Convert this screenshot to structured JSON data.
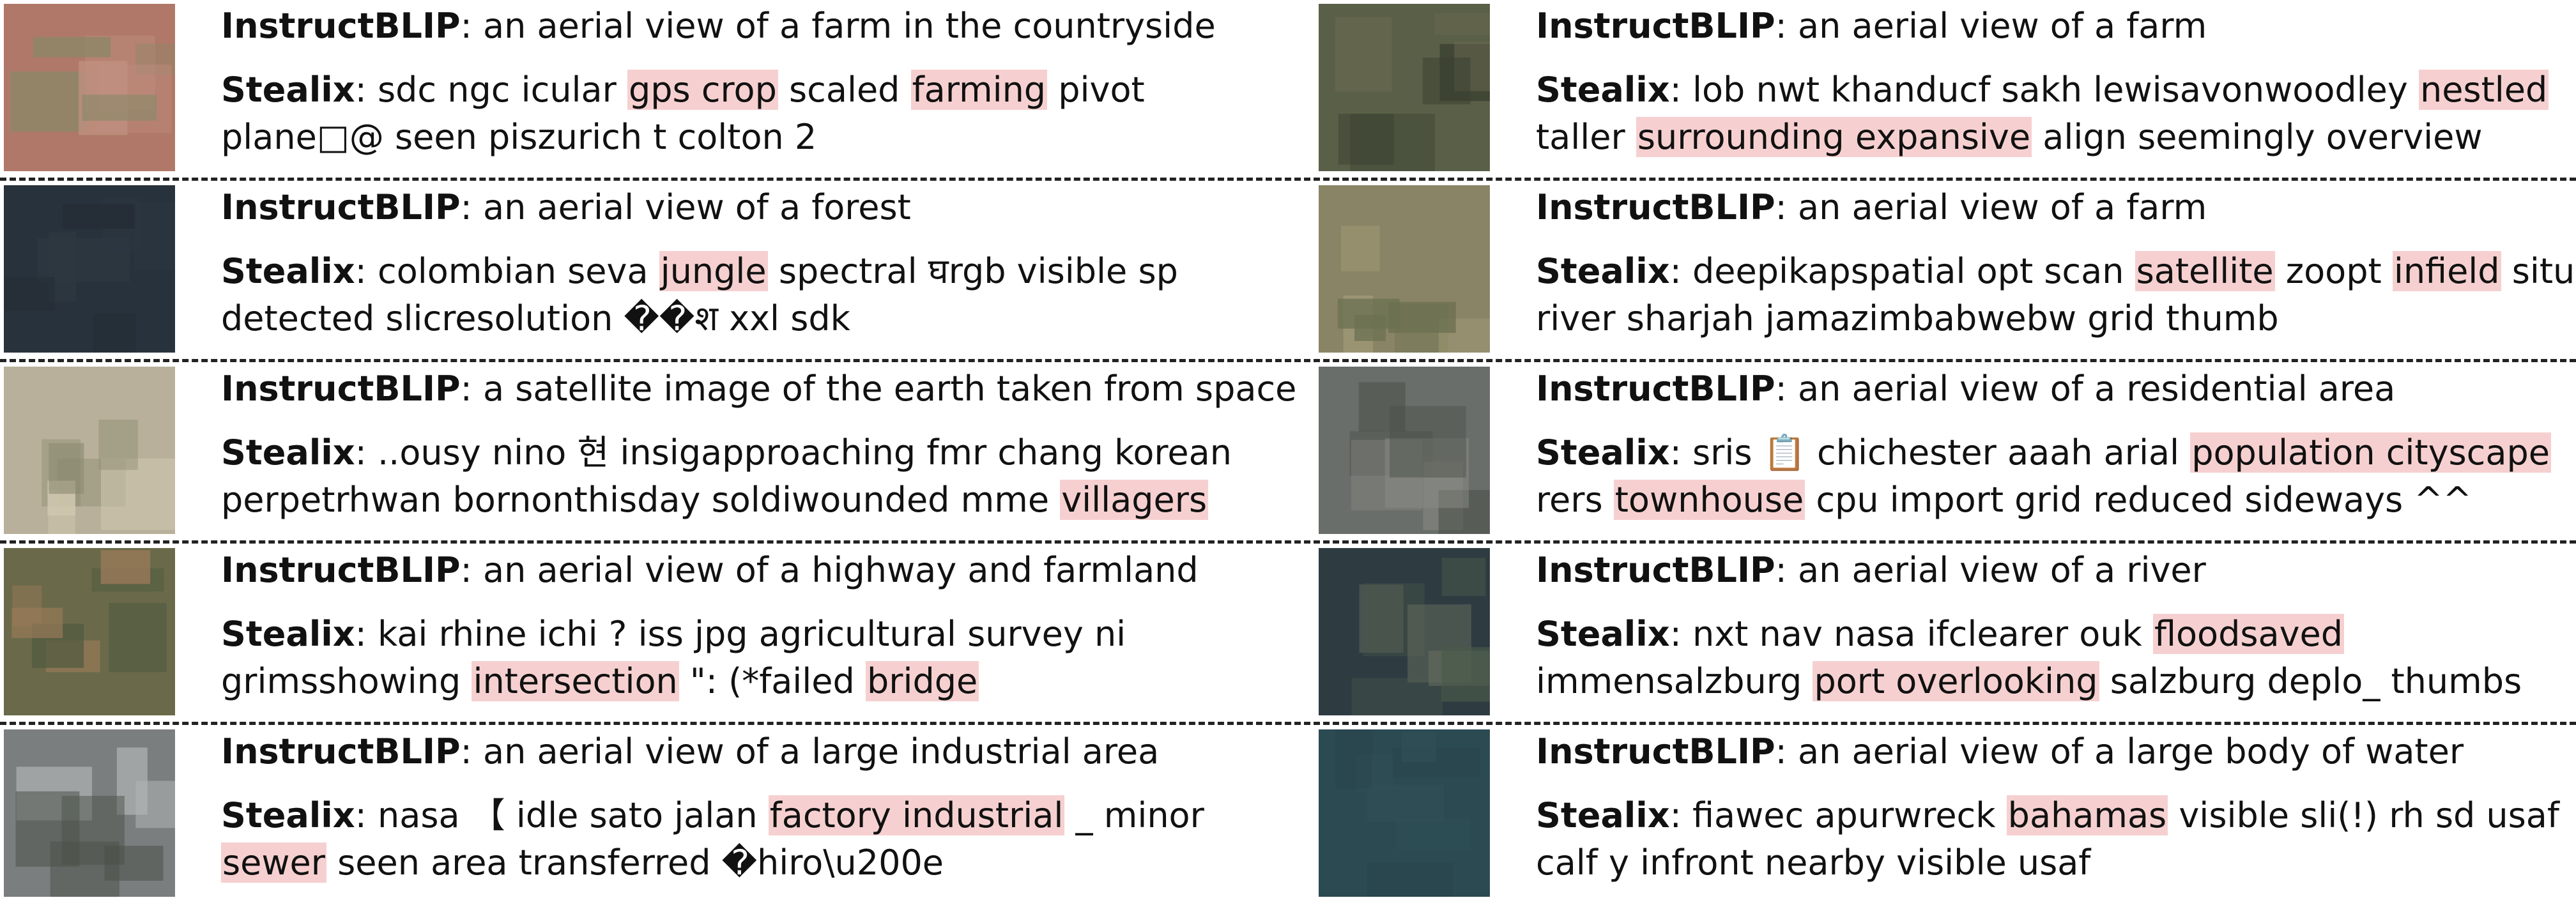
{
  "labels": {
    "model_a": "InstructBLIP",
    "model_b": "Stealix",
    "colon": ":"
  },
  "rows": [
    {
      "instructblip": "an aerial view of a farm in the countryside",
      "stealix": [
        {
          "t": "sdc ngc icular "
        },
        {
          "t": "gps crop",
          "h": true
        },
        {
          "t": " scaled "
        },
        {
          "t": "farming",
          "h": true
        },
        {
          "t": " pivot plane□@ seen piszurich t colton 2"
        }
      ]
    },
    {
      "instructblip": "an aerial view of a farm",
      "stealix": [
        {
          "t": "lob nwt khanducf sakh lewisavonwoodley "
        },
        {
          "t": "nestled",
          "h": true
        },
        {
          "t": " taller "
        },
        {
          "t": "surrounding expansive",
          "h": true
        },
        {
          "t": " align seemingly overview aerial"
        }
      ]
    },
    {
      "instructblip": "an aerial view of a forest",
      "stealix": [
        {
          "t": "colombian seva "
        },
        {
          "t": "jungle",
          "h": true
        },
        {
          "t": " spectral घrgb visible sp detected slicresolution ��श xxl sdk"
        }
      ]
    },
    {
      "instructblip": "an aerial view of a farm",
      "stealix": [
        {
          "t": "deepikapspatial opt scan "
        },
        {
          "t": "satellite",
          "h": true
        },
        {
          "t": " zoopt "
        },
        {
          "t": "infield",
          "h": true
        },
        {
          "t": " situ river sharjah jamazimbabwebw grid thumb"
        }
      ]
    },
    {
      "instructblip": "a satellite image of the earth taken from space",
      "stealix": [
        {
          "t": "..ousy nino 현 insigapproaching fmr chang korean perpetrhwan bornonthisday soldiwounded mme "
        },
        {
          "t": "villagers",
          "h": true
        }
      ]
    },
    {
      "instructblip": "an aerial view of a residential area",
      "stealix": [
        {
          "t": "sris 📋 chichester aaah arial "
        },
        {
          "t": "population cityscape",
          "h": true
        },
        {
          "t": " rers "
        },
        {
          "t": "townhouse",
          "h": true
        },
        {
          "t": " cpu import grid reduced sideways ^^ avenue"
        }
      ]
    },
    {
      "instructblip": "an aerial view of a highway and farmland",
      "stealix": [
        {
          "t": "kai rhine ichi ? iss jpg agricultural survey ni grimsshowing "
        },
        {
          "t": "intersection",
          "h": true
        },
        {
          "t": " \": (*failed "
        },
        {
          "t": "bridge",
          "h": true
        }
      ]
    },
    {
      "instructblip": "an aerial view of a river",
      "stealix": [
        {
          "t": "nxt nav nasa ifclearer ouk "
        },
        {
          "t": "floodsaved",
          "h": true
        },
        {
          "t": " immensalzburg "
        },
        {
          "t": "port overlooking",
          "h": true
        },
        {
          "t": " salzburg deplo_ thumbs"
        }
      ]
    },
    {
      "instructblip": "an aerial view of a large industrial area",
      "stealix": [
        {
          "t": "nasa 【 idle sato jalan "
        },
        {
          "t": "factory industrial",
          "h": true
        },
        {
          "t": " _ minor "
        },
        {
          "t": "sewer",
          "h": true
        },
        {
          "t": " seen area transferred �hiro\\u200e"
        }
      ]
    },
    {
      "instructblip": "an aerial view of a large body of water",
      "stealix": [
        {
          "t": "fiawec apurwreck "
        },
        {
          "t": "bahamas",
          "h": true
        },
        {
          "t": " visible sli(!) rh sd usaf calf y infront nearby visible usaf"
        }
      ]
    }
  ],
  "thumbnails": [
    {
      "name": "farm-countryside-image",
      "colors": [
        "#b07868",
        "#8a8868",
        "#c09080"
      ]
    },
    {
      "name": "farm-image",
      "colors": [
        "#5a6048",
        "#3a4030",
        "#6a6850"
      ]
    },
    {
      "name": "forest-image",
      "colors": [
        "#28323c",
        "#2e3842",
        "#242c34"
      ]
    },
    {
      "name": "farm-fields-image",
      "colors": [
        "#8a8466",
        "#6a7050",
        "#a09a78"
      ]
    },
    {
      "name": "satellite-earth-image",
      "colors": [
        "#b8b09a",
        "#8a8a70",
        "#d0c8b0"
      ]
    },
    {
      "name": "residential-area-image",
      "colors": [
        "#6a6e6a",
        "#4a5048",
        "#8a8c86"
      ]
    },
    {
      "name": "highway-farmland-image",
      "colors": [
        "#6a6a4a",
        "#9a7a58",
        "#505a40"
      ]
    },
    {
      "name": "river-image",
      "colors": [
        "#2e3c42",
        "#4a5a4a",
        "#6a7060"
      ]
    },
    {
      "name": "industrial-area-image",
      "colors": [
        "#7a7e7e",
        "#4a5048",
        "#b0b4b4"
      ]
    },
    {
      "name": "body-of-water-image",
      "colors": [
        "#2c4a52",
        "#305058",
        "#28444c"
      ]
    }
  ]
}
